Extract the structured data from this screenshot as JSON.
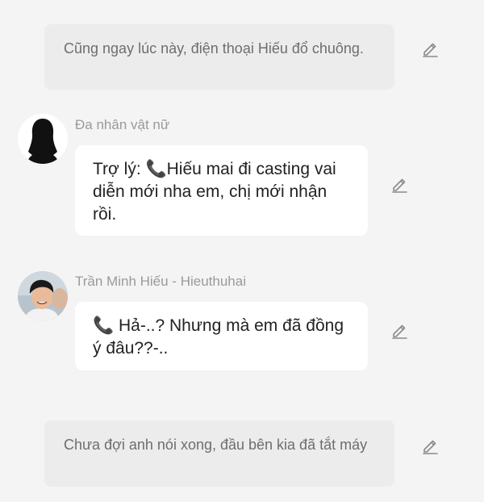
{
  "messages": [
    {
      "type": "narration",
      "text": "Cũng ngay lúc này, điện thoại Hiếu đổ chuông."
    },
    {
      "type": "character",
      "name": "Đa nhân vật nữ",
      "avatar": "female-silhouette-avatar",
      "text": "Trợ lý: 📞Hiếu mai đi casting vai diễn mới nha em, chị mới nhận rồi."
    },
    {
      "type": "character",
      "name": "Trần Minh Hiếu - Hieuthuhai",
      "avatar": "hieu-photo-avatar",
      "text": "📞 Hả-..? Nhưng mà em đã đồng ý đâu??-.."
    },
    {
      "type": "narration",
      "text": "Chưa đợi anh nói xong, đầu bên kia đã tắt máy"
    }
  ],
  "icons": {
    "edit": "pencil-edit-icon"
  },
  "colors": {
    "background": "#f4f4f4",
    "narration_bg": "#ececec",
    "bubble_bg": "#ffffff",
    "name_text": "#9a9a9a"
  }
}
